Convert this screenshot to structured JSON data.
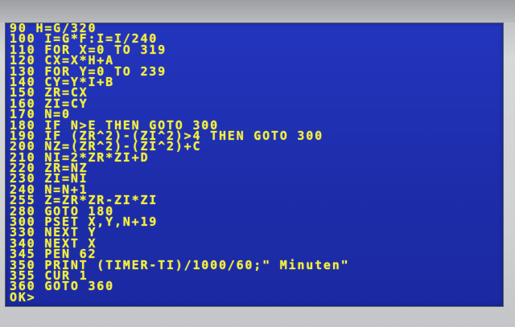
{
  "screen": {
    "lines": [
      "90 H=G/320",
      "100 I=G*F:I=I/240",
      "110 FOR X=0 TO 319",
      "120 CX=X*H+A",
      "130 FOR Y=0 TO 239",
      "140 CY=Y*I+B",
      "150 ZR=CX",
      "160 ZI=CY",
      "170 N=0",
      "180 IF N>E THEN GOTO 300",
      "190 IF (ZR^2)-(ZI^2)>4 THEN GOTO 300",
      "200 NZ=(ZR^2)-(ZI^2)+C",
      "210 NI=2*ZR*ZI+D",
      "220 ZR=NZ",
      "230 ZI=NI",
      "240 N=N+1",
      "255 Z=ZR*ZR-ZI*ZI",
      "280 GOTO 180",
      "300 PSET X,Y,N+19",
      "330 NEXT Y",
      "340 NEXT X",
      "345 PEN 62",
      "350 PRINT (TIMER-TI)/1000/60;\" Minuten\"",
      "355 CUR 1",
      "360 GOTO 360"
    ],
    "prompt": "OK>",
    "text_color": "#f3ef37",
    "background_color": "#1f2fb0"
  }
}
